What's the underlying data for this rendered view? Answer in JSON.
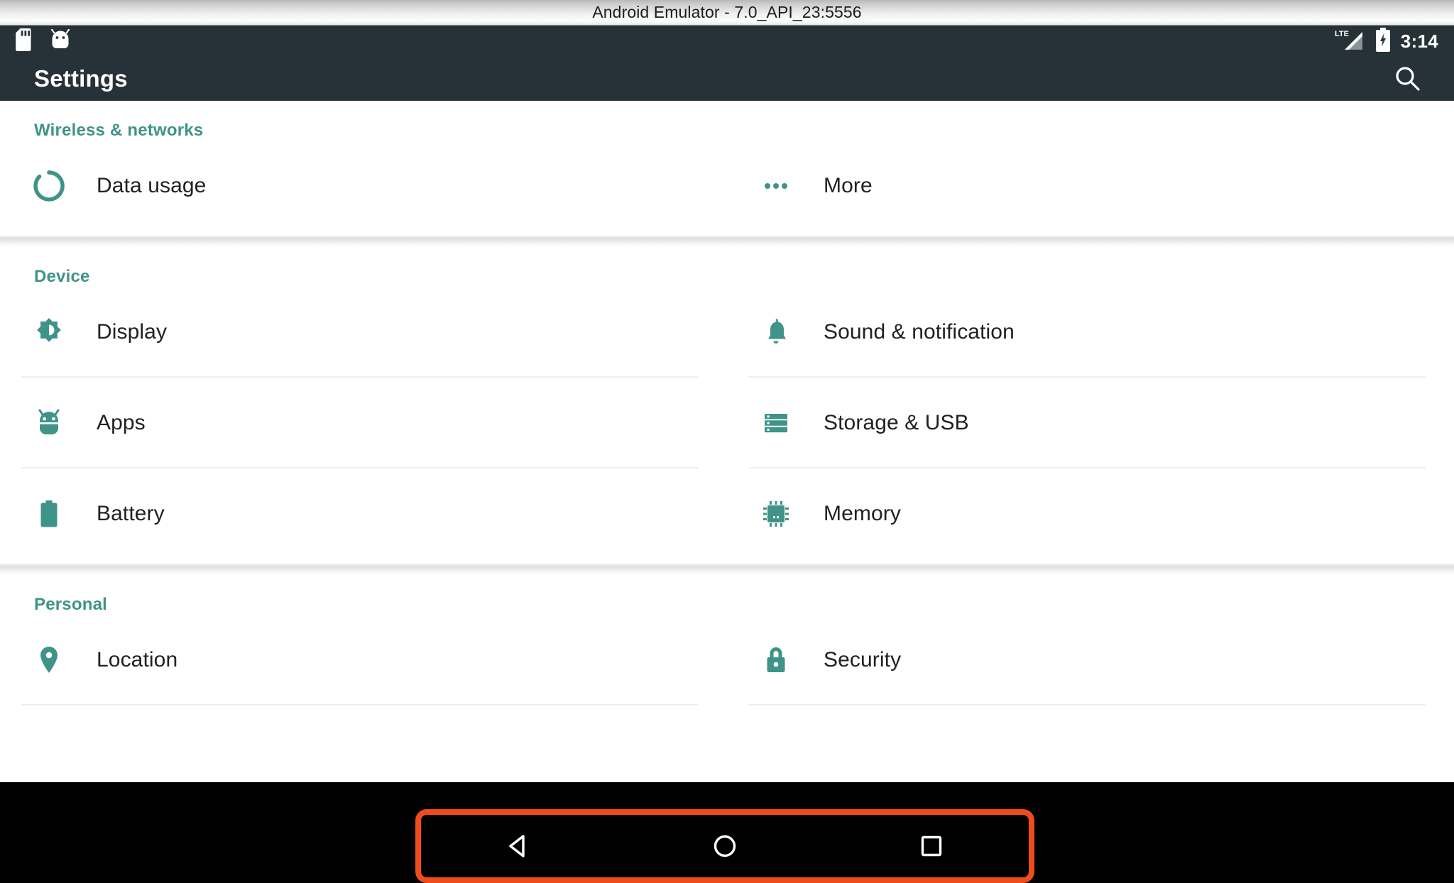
{
  "window": {
    "title": "Android Emulator - 7.0_API_23:5556"
  },
  "status_bar": {
    "icons": [
      "sd-card-icon",
      "android-head-icon"
    ],
    "network_label": "LTE",
    "battery": "charging",
    "time": "3:14"
  },
  "action_bar": {
    "title": "Settings",
    "search_label": "search-icon"
  },
  "colors": {
    "accent_teal": "#409388",
    "action_bar_bg": "#263238",
    "highlight_orange": "#EF4C1C",
    "label_text": "#212121",
    "divider": "#eceff1"
  },
  "sections": [
    {
      "title": "Wireless & networks",
      "items": [
        {
          "label": "Data usage",
          "icon": "data-usage-icon"
        },
        {
          "label": "More",
          "icon": "more-dots-icon"
        }
      ]
    },
    {
      "title": "Device",
      "items": [
        {
          "label": "Display",
          "icon": "brightness-icon"
        },
        {
          "label": "Sound & notification",
          "icon": "bell-icon"
        },
        {
          "label": "Apps",
          "icon": "android-bug-icon"
        },
        {
          "label": "Storage & USB",
          "icon": "storage-icon"
        },
        {
          "label": "Battery",
          "icon": "battery-icon"
        },
        {
          "label": "Memory",
          "icon": "memory-chip-icon"
        }
      ]
    },
    {
      "title": "Personal",
      "items": [
        {
          "label": "Location",
          "icon": "location-pin-icon"
        },
        {
          "label": "Security",
          "icon": "lock-icon"
        }
      ]
    }
  ],
  "nav_bar": {
    "back_label": "back-button",
    "home_label": "home-button",
    "recents_label": "recents-button"
  }
}
